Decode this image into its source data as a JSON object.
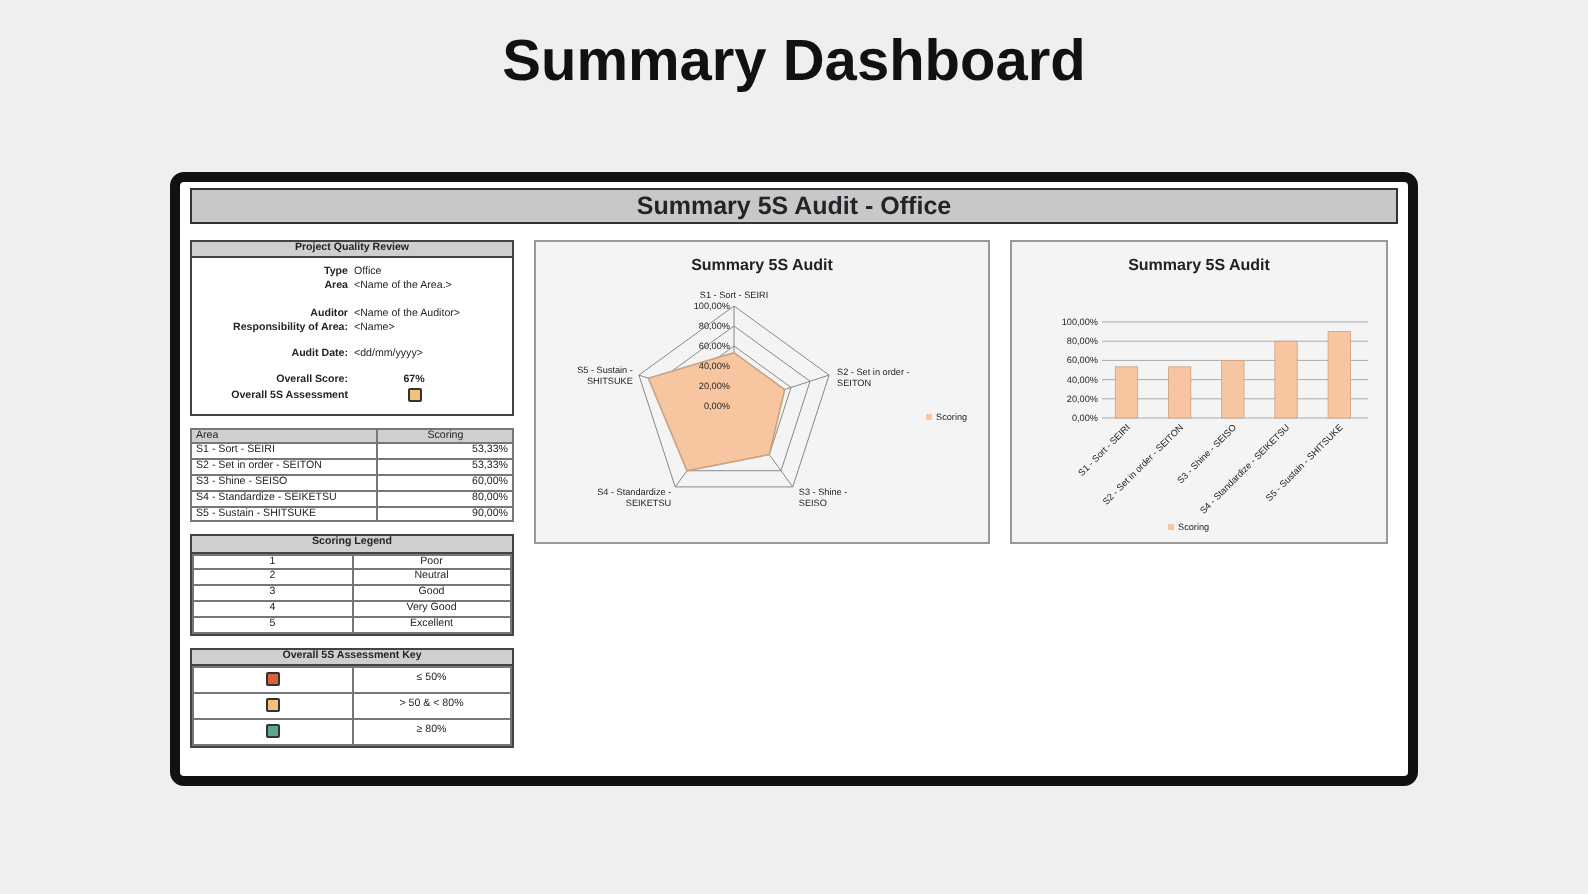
{
  "page_title": "Summary Dashboard",
  "report": {
    "title": "Summary 5S Audit - Office",
    "review": {
      "title": "Project Quality Review",
      "groups": [
        [
          {
            "label": "Type",
            "value": "Office"
          },
          {
            "label": "Area",
            "value": "<Name of the Area.>"
          }
        ],
        [
          {
            "label": "Auditor",
            "value": "<Name of the Auditor>"
          },
          {
            "label": "Responsibility of Area:",
            "value": "<Name>"
          }
        ],
        [
          {
            "label": "Audit Date:",
            "value": "<dd/mm/yyyy>"
          }
        ]
      ],
      "score_label": "Overall Score:",
      "score": "67%",
      "assessment": {
        "label": "Overall 5S Assessment",
        "color": "#f2c27a"
      }
    },
    "scores": {
      "columns": [
        "Area",
        "Scoring"
      ],
      "rows": [
        [
          "S1 - Sort - SEIRI",
          "53,33%"
        ],
        [
          "S2 - Set in order - SEITON",
          "53,33%"
        ],
        [
          "S3 - Shine - SEISO",
          "60,00%"
        ],
        [
          "S4 - Standardize - SEIKETSU",
          "80,00%"
        ],
        [
          "S5 - Sustain - SHITSUKE",
          "90,00%"
        ]
      ]
    },
    "legend": {
      "title": "Scoring Legend",
      "rows": [
        [
          "1",
          "Poor"
        ],
        [
          "2",
          "Neutral"
        ],
        [
          "3",
          "Good"
        ],
        [
          "4",
          "Very Good"
        ],
        [
          "5",
          "Excellent"
        ]
      ]
    },
    "key": {
      "title": "Overall 5S Assessment Key",
      "rows": [
        {
          "color": "#d9613c",
          "label": "≤ 50%"
        },
        {
          "color": "#f2c27a",
          "label": "> 50 & < 80%"
        },
        {
          "color": "#5fa48e",
          "label": "≥ 80%"
        }
      ]
    },
    "radar": {
      "title": "Summary 5S Audit",
      "axis_labels": [
        "S1 - Sort - SEIRI",
        "S5 - Sustain - SHITSUKE",
        "S2 - Set in order - SEITON",
        "S4 - Standardize - SEIKETSU",
        "S3 - Shine - SEISO"
      ],
      "tick_labels": [
        "100,00%",
        "80,00%",
        "60,00%",
        "40,00%",
        "20,00%",
        "0,00%"
      ],
      "legend": "Scoring"
    },
    "bars": {
      "chart_data": {
        "type": "bar",
        "title": "Summary 5S Audit",
        "categories": [
          "S1 - Sort - SEIRI",
          "S2 - Set in order - SEITON",
          "S3 - Shine - SEISO",
          "S4 - Standardize - SEIKETSU",
          "S5 - Sustain - SHITSUKE"
        ],
        "ylim": [
          0,
          100
        ],
        "grid": true,
        "yticks": [
          {
            "value": 0,
            "label": "0,00%"
          },
          {
            "value": 20,
            "label": "20,00%"
          },
          {
            "value": 40,
            "label": "40,00%"
          },
          {
            "value": 60,
            "label": "60,00%"
          },
          {
            "value": 80,
            "label": "80,00%"
          },
          {
            "value": 100,
            "label": "100,00%"
          }
        ],
        "series": [
          {
            "name": "Scoring",
            "color": "#f7c6a0",
            "values": [
              53.33,
              53.33,
              60,
              80,
              90
            ]
          }
        ]
      }
    }
  }
}
